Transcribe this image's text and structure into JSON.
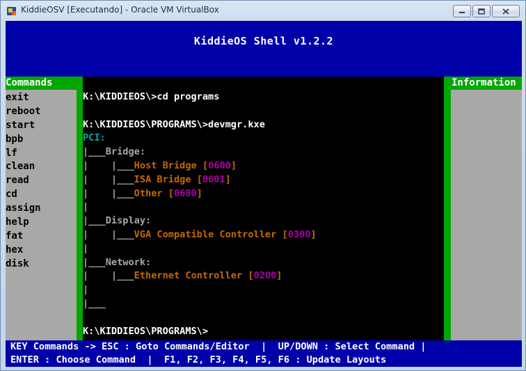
{
  "window": {
    "title": "KiddieOSV [Executando] - Oracle VM VirtualBox",
    "icons": {
      "app": "virtualbox-icon",
      "minimize": "minimize-icon",
      "maximize": "maximize-icon",
      "close": "close-icon"
    }
  },
  "shell": {
    "title": "KiddieOS Shell v1.2.2"
  },
  "commands_panel": {
    "title": "Commands",
    "items": [
      "exit",
      "reboot",
      "start",
      "bpb",
      "lf",
      "clean",
      "read",
      "cd",
      "assign",
      "help",
      "fat",
      "hex",
      "disk"
    ]
  },
  "info_panel": {
    "title": "Information"
  },
  "console": {
    "lines": [
      [
        {
          "t": "K:\\KIDDIEOS\\>cd programs",
          "c": "white"
        }
      ],
      [
        {
          "t": "",
          "c": "white"
        }
      ],
      [
        {
          "t": "K:\\KIDDIEOS\\PROGRAMS\\>devmgr.kxe",
          "c": "white"
        }
      ],
      [
        {
          "t": "PCI:",
          "c": "cyan"
        }
      ],
      [
        {
          "t": "|___Bridge:",
          "c": "gray"
        }
      ],
      [
        {
          "t": "|    |___",
          "c": "gray"
        },
        {
          "t": "Host Bridge [",
          "c": "orange"
        },
        {
          "t": "0600",
          "c": "magenta"
        },
        {
          "t": "]",
          "c": "orange"
        }
      ],
      [
        {
          "t": "|    |___",
          "c": "gray"
        },
        {
          "t": "ISA Bridge [",
          "c": "orange"
        },
        {
          "t": "0601",
          "c": "magenta"
        },
        {
          "t": "]",
          "c": "orange"
        }
      ],
      [
        {
          "t": "|    |___",
          "c": "gray"
        },
        {
          "t": "Other [",
          "c": "orange"
        },
        {
          "t": "0680",
          "c": "magenta"
        },
        {
          "t": "]",
          "c": "orange"
        }
      ],
      [
        {
          "t": "|",
          "c": "gray"
        }
      ],
      [
        {
          "t": "|___Display:",
          "c": "gray"
        }
      ],
      [
        {
          "t": "|    |___",
          "c": "gray"
        },
        {
          "t": "VGA Compatible Controller [",
          "c": "orange"
        },
        {
          "t": "0300",
          "c": "magenta"
        },
        {
          "t": "]",
          "c": "orange"
        }
      ],
      [
        {
          "t": "|",
          "c": "gray"
        }
      ],
      [
        {
          "t": "|___Network:",
          "c": "gray"
        }
      ],
      [
        {
          "t": "|    |___",
          "c": "gray"
        },
        {
          "t": "Ethernet Controller [",
          "c": "orange"
        },
        {
          "t": "0200",
          "c": "magenta"
        },
        {
          "t": "]",
          "c": "orange"
        }
      ],
      [
        {
          "t": "|",
          "c": "gray"
        }
      ],
      [
        {
          "t": "|___",
          "c": "gray"
        }
      ],
      [
        {
          "t": "",
          "c": "white"
        }
      ],
      [
        {
          "t": "K:\\KIDDIEOS\\PROGRAMS\\>",
          "c": "white"
        }
      ]
    ]
  },
  "footer": {
    "line1": "KEY Commands -> ESC : Goto Commands/Editor  |  UP/DOWN : Select Command |",
    "line2": "ENTER : Choose Command  |  F1, F2, F3, F4, F5, F6 : Update Layouts"
  },
  "colors": {
    "header_bg": "#0000a8",
    "panel_bg": "#a8a8a8",
    "panel_title_bg": "#00a800",
    "console_bg": "#000000",
    "path_text": "#ffffff",
    "tree_text": "#a8a8a8",
    "category_text": "#00a8a8",
    "device_text": "#c56a00",
    "code_text": "#a800a8"
  }
}
